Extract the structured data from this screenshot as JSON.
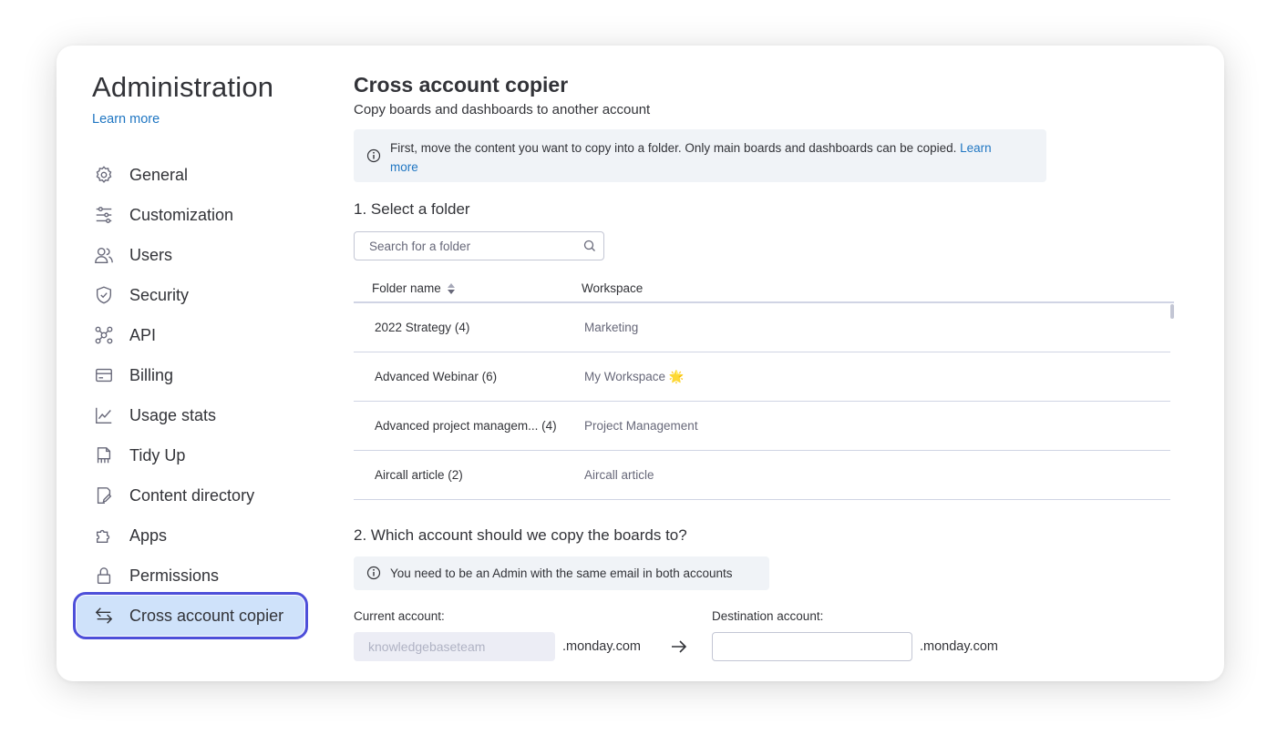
{
  "sidebar": {
    "title": "Administration",
    "learn_more": "Learn more",
    "items": [
      {
        "label": "General",
        "icon": "gear-icon"
      },
      {
        "label": "Customization",
        "icon": "sliders-icon"
      },
      {
        "label": "Users",
        "icon": "users-icon"
      },
      {
        "label": "Security",
        "icon": "shield-icon"
      },
      {
        "label": "API",
        "icon": "api-icon"
      },
      {
        "label": "Billing",
        "icon": "credit-card-icon"
      },
      {
        "label": "Usage stats",
        "icon": "chart-icon"
      },
      {
        "label": "Tidy Up",
        "icon": "broom-icon"
      },
      {
        "label": "Content directory",
        "icon": "document-edit-icon"
      },
      {
        "label": "Apps",
        "icon": "puzzle-icon"
      },
      {
        "label": "Permissions",
        "icon": "lock-icon"
      },
      {
        "label": "Cross account copier",
        "icon": "swap-arrows-icon",
        "active": true
      }
    ]
  },
  "main": {
    "title": "Cross account copier",
    "subtitle": "Copy boards and dashboards to another account",
    "info": {
      "text": "First, move the content you want to copy into a folder. Only main boards and dashboards can be copied.",
      "link": "Learn more"
    },
    "step1": {
      "title": "1. Select a folder",
      "search_placeholder": "Search for a folder"
    },
    "table": {
      "columns": [
        "Folder name",
        "Workspace"
      ],
      "rows": [
        {
          "folder": "2022 Strategy",
          "count": "(4)",
          "workspace": "Marketing"
        },
        {
          "folder": "Advanced Webinar",
          "count": "(6)",
          "workspace": "My Workspace 🌟"
        },
        {
          "folder": "Advanced project managem...",
          "count": "(4)",
          "workspace": "Project Management"
        },
        {
          "folder": "Aircall article",
          "count": "(2)",
          "workspace": "Aircall article"
        }
      ]
    },
    "step2": {
      "title": "2. Which account should we copy the boards to?",
      "info": "You need to be an Admin with the same email in both accounts",
      "current_label": "Current account:",
      "current_value": "knowledgebaseteam",
      "destination_label": "Destination account:",
      "destination_value": "",
      "domain_suffix": ".monday.com"
    }
  },
  "colors": {
    "accent": "#1f76c2",
    "active_bg": "#cfe2fa",
    "active_outline": "#4d4fd9",
    "info_bg": "#f0f3f7"
  }
}
